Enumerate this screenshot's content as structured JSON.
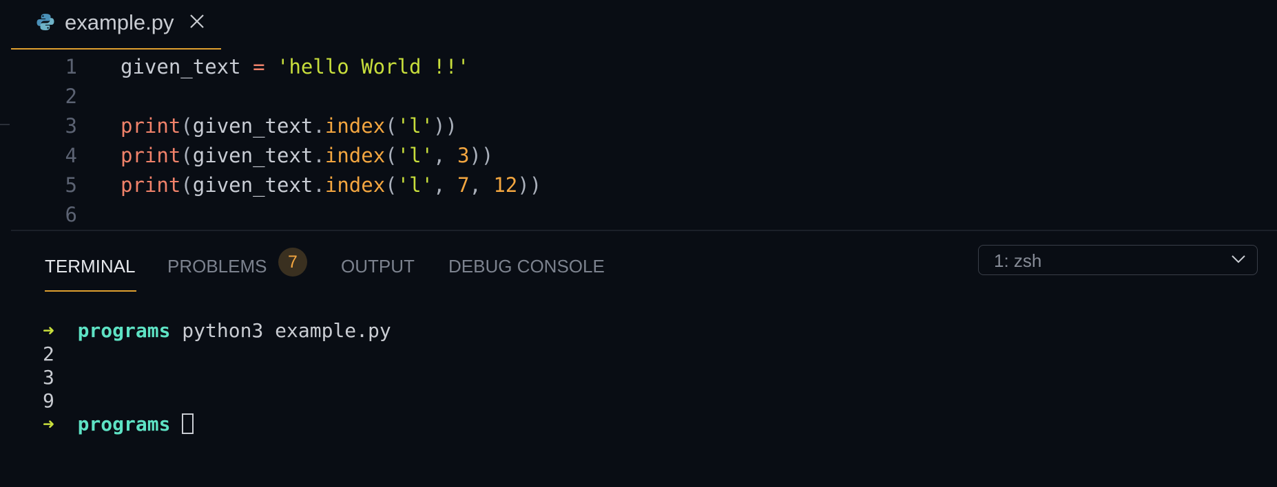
{
  "tab": {
    "filename": "example.py",
    "icon": "python-icon",
    "close_icon": "close-icon"
  },
  "editor": {
    "lines": [
      {
        "n": "1",
        "tokens": [
          {
            "t": "given_text ",
            "c": "plain"
          },
          {
            "t": "=",
            "c": "op"
          },
          {
            "t": " ",
            "c": "plain"
          },
          {
            "t": "'hello World !!'",
            "c": "str"
          }
        ]
      },
      {
        "n": "2",
        "tokens": []
      },
      {
        "n": "3",
        "tokens": [
          {
            "t": "print",
            "c": "kw"
          },
          {
            "t": "(",
            "c": "pn"
          },
          {
            "t": "given_text",
            "c": "plain"
          },
          {
            "t": ".",
            "c": "pn"
          },
          {
            "t": "index",
            "c": "fn"
          },
          {
            "t": "(",
            "c": "pn"
          },
          {
            "t": "'l'",
            "c": "str"
          },
          {
            "t": "))",
            "c": "pn"
          }
        ]
      },
      {
        "n": "4",
        "tokens": [
          {
            "t": "print",
            "c": "kw"
          },
          {
            "t": "(",
            "c": "pn"
          },
          {
            "t": "given_text",
            "c": "plain"
          },
          {
            "t": ".",
            "c": "pn"
          },
          {
            "t": "index",
            "c": "fn"
          },
          {
            "t": "(",
            "c": "pn"
          },
          {
            "t": "'l'",
            "c": "str"
          },
          {
            "t": ", ",
            "c": "pn"
          },
          {
            "t": "3",
            "c": "num"
          },
          {
            "t": "))",
            "c": "pn"
          }
        ]
      },
      {
        "n": "5",
        "tokens": [
          {
            "t": "print",
            "c": "kw"
          },
          {
            "t": "(",
            "c": "pn"
          },
          {
            "t": "given_text",
            "c": "plain"
          },
          {
            "t": ".",
            "c": "pn"
          },
          {
            "t": "index",
            "c": "fn"
          },
          {
            "t": "(",
            "c": "pn"
          },
          {
            "t": "'l'",
            "c": "str"
          },
          {
            "t": ", ",
            "c": "pn"
          },
          {
            "t": "7",
            "c": "num"
          },
          {
            "t": ", ",
            "c": "pn"
          },
          {
            "t": "12",
            "c": "num"
          },
          {
            "t": "))",
            "c": "pn"
          }
        ]
      },
      {
        "n": "6",
        "tokens": []
      }
    ]
  },
  "panel": {
    "tabs": [
      {
        "label": "TERMINAL",
        "active": true
      },
      {
        "label": "PROBLEMS",
        "active": false
      },
      {
        "label": "OUTPUT",
        "active": false
      },
      {
        "label": "DEBUG CONSOLE",
        "active": false
      }
    ],
    "problems_count": "7",
    "shell_select": "1: zsh",
    "shell_chevron": "chevron-down-icon"
  },
  "terminal": {
    "prompt_arrow": "➜",
    "prompt_dir": "programs",
    "command": "python3 example.py",
    "outputs": [
      "2",
      "3",
      "9"
    ],
    "final_prompt_dir": "programs"
  },
  "colors": {
    "background": "#090d14",
    "accent": "#e0a030",
    "keyword": "#f0826a",
    "function": "#f3a640",
    "string": "#c8de3c",
    "terminal_dir": "#5ee2c4"
  }
}
